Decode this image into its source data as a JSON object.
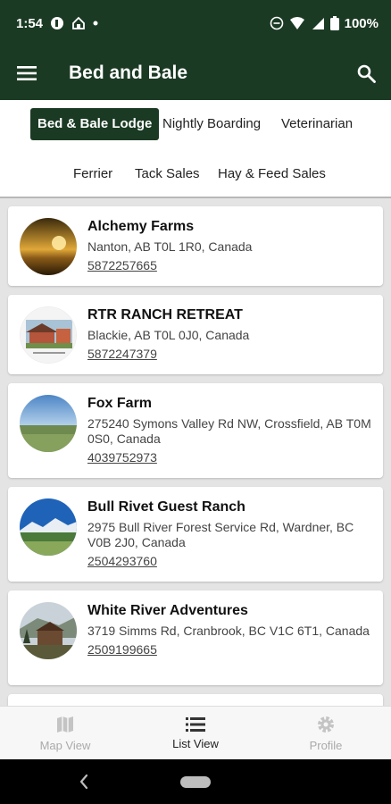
{
  "status_bar": {
    "time": "1:54",
    "battery": "100%"
  },
  "app_bar": {
    "title": "Bed and Bale",
    "menu_icon": "hamburger-menu-icon",
    "search_icon": "search-icon"
  },
  "categories": [
    {
      "label": "Bed & Bale Lodge",
      "active": true
    },
    {
      "label": "Nightly Boarding",
      "active": false
    },
    {
      "label": "Veterinarian",
      "active": false
    },
    {
      "label": "Ferrier",
      "active": false
    },
    {
      "label": "Tack Sales",
      "active": false
    },
    {
      "label": "Hay & Feed Sales",
      "active": false
    }
  ],
  "listings": [
    {
      "name": "Alchemy Farms",
      "address": "Nanton, AB T0L 1R0, Canada",
      "phone": "5872257665"
    },
    {
      "name": "RTR RANCH RETREAT",
      "address": "Blackie, AB T0L 0J0, Canada",
      "phone": "5872247379"
    },
    {
      "name": "Fox Farm",
      "address": "275240 Symons Valley Rd NW, Crossfield, AB T0M 0S0, Canada",
      "phone": "4039752973"
    },
    {
      "name": "Bull Rivet Guest Ranch",
      "address": "2975 Bull River Forest Service Rd, Wardner, BC V0B 2J0, Canada",
      "phone": "2504293760"
    },
    {
      "name": "White River Adventures",
      "address": "3719 Simms Rd, Cranbrook, BC V1C 6T1, Canada",
      "phone": "2509199665"
    }
  ],
  "bottom_nav": [
    {
      "label": "Map View",
      "icon": "map-icon",
      "active": false
    },
    {
      "label": "List View",
      "icon": "list-icon",
      "active": true
    },
    {
      "label": "Profile",
      "icon": "gear-icon",
      "active": false
    }
  ],
  "colors": {
    "primary": "#1b3a24",
    "background": "#e4e4e4",
    "card": "#ffffff",
    "nav_inactive": "#aaaaaa"
  }
}
